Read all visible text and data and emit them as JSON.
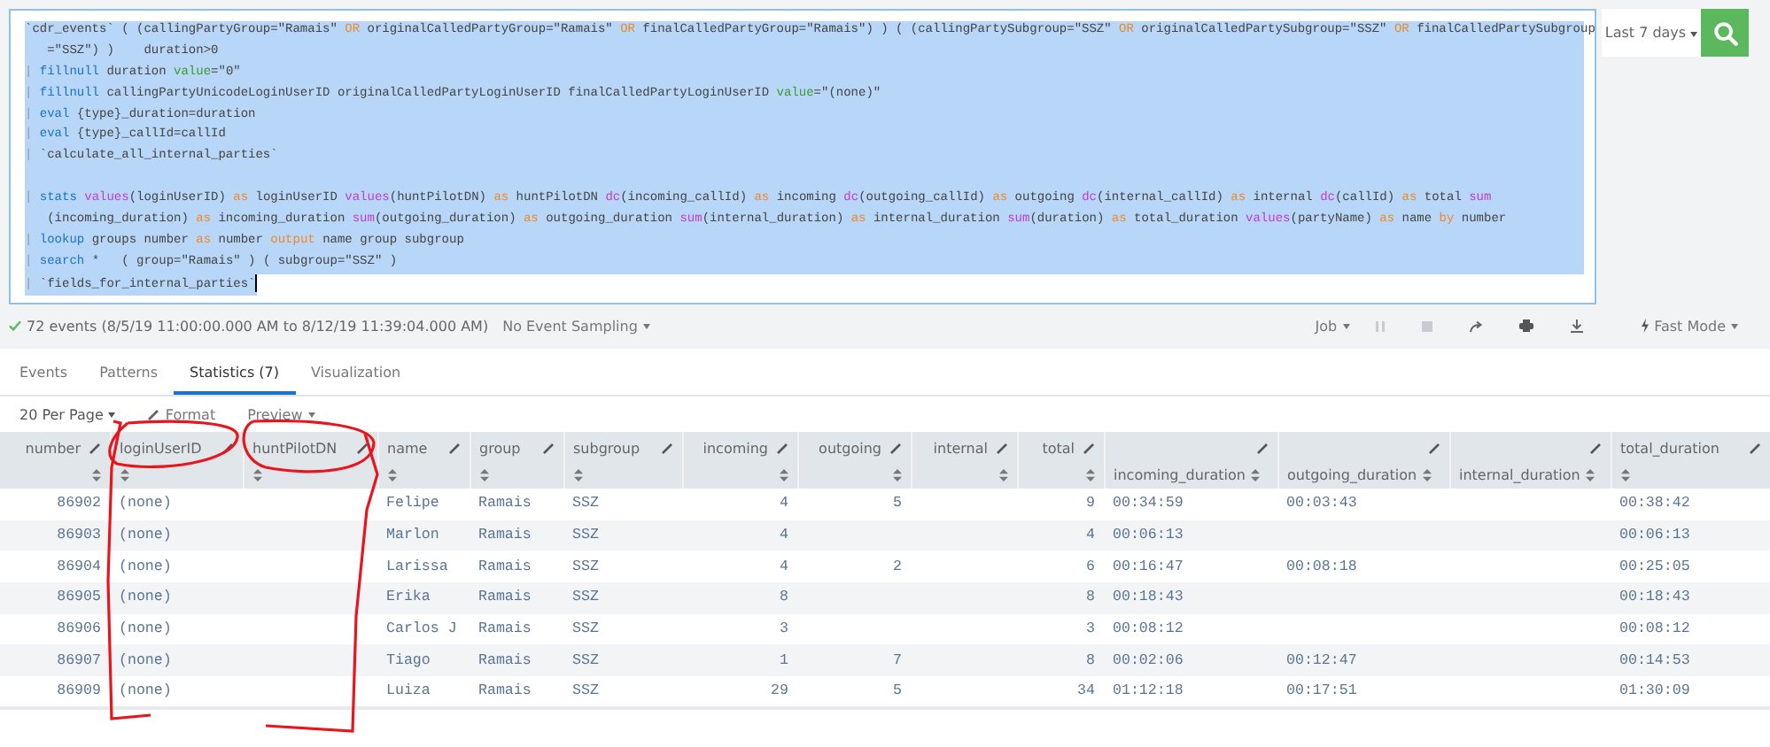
{
  "query": {
    "selected": true,
    "lines": [
      {
        "kind": "code",
        "tokens": [
          {
            "kind": "text",
            "t": "`cdr_events` ( (callingPartyGroup=\"Ramais\" "
          },
          {
            "kind": "op",
            "t": "OR"
          },
          {
            "kind": "text",
            "t": " originalCalledPartyGroup=\"Ramais\" "
          },
          {
            "kind": "op",
            "t": "OR"
          },
          {
            "kind": "text",
            "t": " finalCalledPartyGroup=\"Ramais\") ) ( (callingPartySubgroup=\"SSZ\" "
          },
          {
            "kind": "op",
            "t": "OR"
          },
          {
            "kind": "text",
            "t": " originalCalledPartySubgroup=\"SSZ\" "
          },
          {
            "kind": "op",
            "t": "OR"
          },
          {
            "kind": "text",
            "t": " finalCalledPartySubgroup"
          }
        ]
      },
      {
        "kind": "code",
        "tokens": [
          {
            "kind": "text",
            "t": "   =\"SSZ\") )    duration>0"
          }
        ]
      },
      {
        "kind": "code",
        "tokens": [
          {
            "kind": "pipe",
            "t": "| "
          },
          {
            "kind": "cmd",
            "t": "fillnull"
          },
          {
            "kind": "text",
            "t": " duration "
          },
          {
            "kind": "arg",
            "t": "value"
          },
          {
            "kind": "text",
            "t": "=\"0\""
          }
        ]
      },
      {
        "kind": "code",
        "tokens": [
          {
            "kind": "pipe",
            "t": "| "
          },
          {
            "kind": "cmd",
            "t": "fillnull"
          },
          {
            "kind": "text",
            "t": " callingPartyUnicodeLoginUserID originalCalledPartyLoginUserID finalCalledPartyLoginUserID "
          },
          {
            "kind": "arg",
            "t": "value"
          },
          {
            "kind": "text",
            "t": "=\"(none)\""
          }
        ]
      },
      {
        "kind": "code",
        "tokens": [
          {
            "kind": "pipe",
            "t": "| "
          },
          {
            "kind": "cmd",
            "t": "eval"
          },
          {
            "kind": "text",
            "t": " {type}_duration=duration"
          }
        ]
      },
      {
        "kind": "code",
        "tokens": [
          {
            "kind": "pipe",
            "t": "| "
          },
          {
            "kind": "cmd",
            "t": "eval"
          },
          {
            "kind": "text",
            "t": " {type}_callId=callId"
          }
        ]
      },
      {
        "kind": "code",
        "tokens": [
          {
            "kind": "pipe",
            "t": "| "
          },
          {
            "kind": "text",
            "t": "`calculate_all_internal_parties`"
          }
        ]
      },
      {
        "kind": "blank"
      },
      {
        "kind": "code",
        "tokens": [
          {
            "kind": "pipe",
            "t": "| "
          },
          {
            "kind": "cmd",
            "t": "stats"
          },
          {
            "kind": "func",
            "t": " values"
          },
          {
            "kind": "text",
            "t": "(loginUserID) "
          },
          {
            "kind": "op",
            "t": "as"
          },
          {
            "kind": "text",
            "t": " loginUserID "
          },
          {
            "kind": "func",
            "t": "values"
          },
          {
            "kind": "text",
            "t": "(huntPilotDN) "
          },
          {
            "kind": "op",
            "t": "as"
          },
          {
            "kind": "text",
            "t": " huntPilotDN "
          },
          {
            "kind": "func",
            "t": "dc"
          },
          {
            "kind": "text",
            "t": "(incoming_callId) "
          },
          {
            "kind": "op",
            "t": "as"
          },
          {
            "kind": "text",
            "t": " incoming "
          },
          {
            "kind": "func",
            "t": "dc"
          },
          {
            "kind": "text",
            "t": "(outgoing_callId) "
          },
          {
            "kind": "op",
            "t": "as"
          },
          {
            "kind": "text",
            "t": " outgoing "
          },
          {
            "kind": "func",
            "t": "dc"
          },
          {
            "kind": "text",
            "t": "(internal_callId) "
          },
          {
            "kind": "op",
            "t": "as"
          },
          {
            "kind": "text",
            "t": " internal "
          },
          {
            "kind": "func",
            "t": "dc"
          },
          {
            "kind": "text",
            "t": "(callId) "
          },
          {
            "kind": "op",
            "t": "as"
          },
          {
            "kind": "text",
            "t": " total "
          },
          {
            "kind": "func",
            "t": "sum"
          }
        ]
      },
      {
        "kind": "code",
        "tokens": [
          {
            "kind": "text",
            "t": "   (incoming_duration) "
          },
          {
            "kind": "op",
            "t": "as"
          },
          {
            "kind": "text",
            "t": " incoming_duration "
          },
          {
            "kind": "func",
            "t": "sum"
          },
          {
            "kind": "text",
            "t": "(outgoing_duration) "
          },
          {
            "kind": "op",
            "t": "as"
          },
          {
            "kind": "text",
            "t": " outgoing_duration "
          },
          {
            "kind": "func",
            "t": "sum"
          },
          {
            "kind": "text",
            "t": "(internal_duration) "
          },
          {
            "kind": "op",
            "t": "as"
          },
          {
            "kind": "text",
            "t": " internal_duration "
          },
          {
            "kind": "func",
            "t": "sum"
          },
          {
            "kind": "text",
            "t": "(duration) "
          },
          {
            "kind": "op",
            "t": "as"
          },
          {
            "kind": "text",
            "t": " total_duration "
          },
          {
            "kind": "func",
            "t": "values"
          },
          {
            "kind": "text",
            "t": "(partyName) "
          },
          {
            "kind": "op",
            "t": "as"
          },
          {
            "kind": "text",
            "t": " name "
          },
          {
            "kind": "op",
            "t": "by"
          },
          {
            "kind": "text",
            "t": " number"
          }
        ]
      },
      {
        "kind": "code",
        "tokens": [
          {
            "kind": "pipe",
            "t": "| "
          },
          {
            "kind": "cmd",
            "t": "lookup"
          },
          {
            "kind": "text",
            "t": " groups number "
          },
          {
            "kind": "op",
            "t": "as"
          },
          {
            "kind": "text",
            "t": " number "
          },
          {
            "kind": "op",
            "t": "output"
          },
          {
            "kind": "text",
            "t": " name group subgroup"
          }
        ]
      },
      {
        "kind": "code",
        "tokens": [
          {
            "kind": "pipe",
            "t": "| "
          },
          {
            "kind": "cmd",
            "t": "search"
          },
          {
            "kind": "text",
            "t": " *   ( group=\"Ramais\" ) ( subgroup=\"SSZ\" )"
          }
        ]
      },
      {
        "kind": "code",
        "tokens": [
          {
            "kind": "pipe",
            "t": "| "
          },
          {
            "kind": "text",
            "t": "`fields_for_internal_parties`"
          }
        ]
      }
    ]
  },
  "time_range": "Last 7 days",
  "status": {
    "summary": "72 events (8/5/19 11:00:00.000 AM to 8/12/19 11:39:04.000 AM)",
    "sampling": "No Event Sampling",
    "job": "Job",
    "mode": "Fast Mode"
  },
  "tabs": [
    {
      "label": "Events",
      "selected": false
    },
    {
      "label": "Patterns",
      "selected": false
    },
    {
      "label": "Statistics (7)",
      "selected": true
    },
    {
      "label": "Visualization",
      "selected": false
    }
  ],
  "toolbar": {
    "per_page": "20 Per Page",
    "format": "Format",
    "preview": "Preview"
  },
  "table": {
    "columns": [
      {
        "label": "number",
        "kind": "numeric"
      },
      {
        "label": "loginUserID",
        "kind": "text"
      },
      {
        "label": "huntPilotDN",
        "kind": "text"
      },
      {
        "label": "name",
        "kind": "text"
      },
      {
        "label": "group",
        "kind": "text"
      },
      {
        "label": "subgroup",
        "kind": "text"
      },
      {
        "label": "incoming",
        "kind": "numeric"
      },
      {
        "label": "outgoing",
        "kind": "numeric"
      },
      {
        "label": "internal",
        "kind": "numeric"
      },
      {
        "label": "total",
        "kind": "numeric"
      },
      {
        "label": "incoming_duration",
        "kind": "duration"
      },
      {
        "label": "outgoing_duration",
        "kind": "duration"
      },
      {
        "label": "internal_duration",
        "kind": "duration"
      },
      {
        "label": "total_duration",
        "kind": "text"
      }
    ],
    "rows": [
      [
        "86902",
        "(none)",
        "",
        "Felipe",
        "Ramais",
        "SSZ",
        "4",
        "5",
        "",
        "9",
        "00:34:59",
        "00:03:43",
        "",
        "00:38:42"
      ],
      [
        "86903",
        "(none)",
        "",
        "Marlon",
        "Ramais",
        "SSZ",
        "4",
        "",
        "",
        "4",
        "00:06:13",
        "",
        "",
        "00:06:13"
      ],
      [
        "86904",
        "(none)",
        "",
        "Larissa",
        "Ramais",
        "SSZ",
        "4",
        "2",
        "",
        "6",
        "00:16:47",
        "00:08:18",
        "",
        "00:25:05"
      ],
      [
        "86905",
        "(none)",
        "",
        "Erika",
        "Ramais",
        "SSZ",
        "8",
        "",
        "",
        "8",
        "00:18:43",
        "",
        "",
        "00:18:43"
      ],
      [
        "86906",
        "(none)",
        "",
        "Carlos J",
        "Ramais",
        "SSZ",
        "3",
        "",
        "",
        "3",
        "00:08:12",
        "",
        "",
        "00:08:12"
      ],
      [
        "86907",
        "(none)",
        "",
        "Tiago",
        "Ramais",
        "SSZ",
        "1",
        "7",
        "",
        "8",
        "00:02:06",
        "00:12:47",
        "",
        "00:14:53"
      ],
      [
        "86909",
        "(none)",
        "",
        "Luiza",
        "Ramais",
        "SSZ",
        "29",
        "5",
        "",
        "34",
        "01:12:18",
        "00:17:51",
        "",
        "01:30:09"
      ]
    ]
  }
}
